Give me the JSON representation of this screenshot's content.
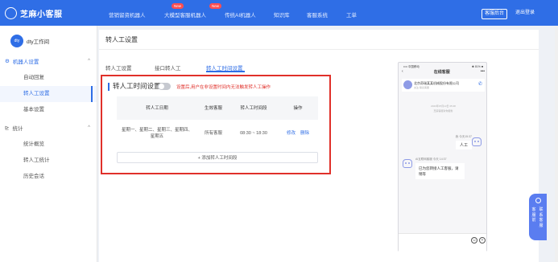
{
  "app": {
    "name": "芝麻小客服",
    "workspace": "dty工作间",
    "workspace_badge": "dty"
  },
  "top_nav": {
    "items": [
      {
        "label": "营销留资机器人"
      },
      {
        "label": "大模型客服机器人",
        "badge": "New"
      },
      {
        "label": "传统AI机器人",
        "badge": "New"
      },
      {
        "label": "知识库"
      },
      {
        "label": "客服系统"
      },
      {
        "label": "工单"
      }
    ],
    "service_button": "客服后台",
    "logout_button": "退出登录"
  },
  "sidebar": {
    "group_robot": "机器人设置",
    "robot_items": [
      "自动回复",
      "转人工设置",
      "基本设置"
    ],
    "group_stats": "统计",
    "stats_items": [
      "统计概览",
      "转人工统计",
      "历史会话"
    ],
    "active_item": "转人工设置"
  },
  "page": {
    "title": "转人工设置",
    "tabs": [
      "转人工设置",
      "接口转人工",
      "转人工时间设置"
    ],
    "active_tab": "转人工时间设置"
  },
  "section": {
    "title": "转人工时间设置",
    "toggle_on": false,
    "hint": "设置后,用户在非设置时间内无法触发转人工操作",
    "columns": [
      "转人工日期",
      "生效客服",
      "转人工时间段",
      "操作"
    ],
    "row": {
      "dates": "星期一、星期二、星期三、星期四、星期五",
      "agents": "所有客服",
      "time_range": "08:30 ~ 18:30",
      "edit": "修改",
      "delete": "删除"
    },
    "add_button": "+ 添加转人工时间段"
  },
  "preview": {
    "status_left": "•••• 中国移动",
    "status_right": "✱ 81% ■",
    "header_title": "在线客服",
    "header_back": "‹",
    "header_more": "•••",
    "bot_name": "北京奇瑞某某机械股份有限公司",
    "bot_sub": "关注·联系客服",
    "call_icon": "✆",
    "time_line1": "2023年07月13日 05:48",
    "time_line2": "芝麻客服对你服务",
    "user_label": "我 今天15:37",
    "user_msg": "人工",
    "ai_label": "AI互联网客服 今天 14:37",
    "ai_msg": "已为您转接人工客服，请稍等",
    "emoji_icon": "☺",
    "plus_icon": "+"
  },
  "float_button": {
    "col1": "客服前",
    "col2": "联系客服"
  }
}
